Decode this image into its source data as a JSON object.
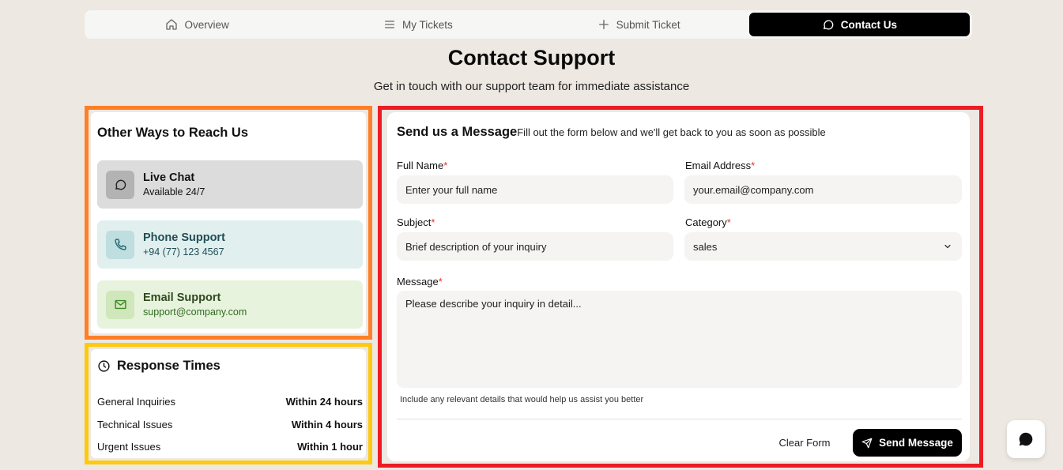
{
  "tabs": [
    {
      "label": "Overview",
      "icon": "home-icon",
      "active": false
    },
    {
      "label": "My Tickets",
      "icon": "list-icon",
      "active": false
    },
    {
      "label": "Submit Ticket",
      "icon": "plus-icon",
      "active": false
    },
    {
      "label": "Contact Us",
      "icon": "message-circle-icon",
      "active": true
    }
  ],
  "page": {
    "title": "Contact Support",
    "subtitle": "Get in touch with our support team for immediate assistance"
  },
  "reach": {
    "title": "Other Ways to Reach Us",
    "items": [
      {
        "title": "Live Chat",
        "detail": "Available 24/7",
        "icon": "message-circle-icon",
        "bg": "#DCDCDC",
        "icon_bg": "#B3B3B3",
        "color": "#111111"
      },
      {
        "title": "Phone Support",
        "detail": "+94 (77) 123 4567",
        "icon": "phone-icon",
        "bg": "#E1EFEF",
        "icon_bg": "#BEDEDF",
        "color": "#1F4E55"
      },
      {
        "title": "Email Support",
        "detail": "support@company.com",
        "icon": "mail-icon",
        "bg": "#E8F3DE",
        "icon_bg": "#CFE7BB",
        "color": "#2F6B1E"
      }
    ]
  },
  "response": {
    "title": "Response Times",
    "icon": "clock-icon",
    "rows": [
      {
        "label": "General Inquiries",
        "value": "Within 24 hours"
      },
      {
        "label": "Technical Issues",
        "value": "Within 4 hours"
      },
      {
        "label": "Urgent Issues",
        "value": "Within 1 hour"
      }
    ]
  },
  "form": {
    "title": "Send us a Message",
    "subtitle": "Fill out the form below and we'll get back to you as soon as possible",
    "full_name": {
      "label": "Full Name",
      "placeholder": "Enter your full name"
    },
    "email": {
      "label": "Email Address",
      "value": "your.email@company.com"
    },
    "subject": {
      "label": "Subject",
      "placeholder": "Brief description of your inquiry"
    },
    "category": {
      "label": "Category",
      "value": "sales"
    },
    "message": {
      "label": "Message",
      "placeholder": "Please describe your inquiry in detail..."
    },
    "required_mark": "*",
    "hint": "Include any relevant details that would help us assist you better",
    "clear_label": "Clear Form",
    "send_label": "Send Message"
  },
  "fab": {
    "icon": "chat-bubble-icon"
  }
}
